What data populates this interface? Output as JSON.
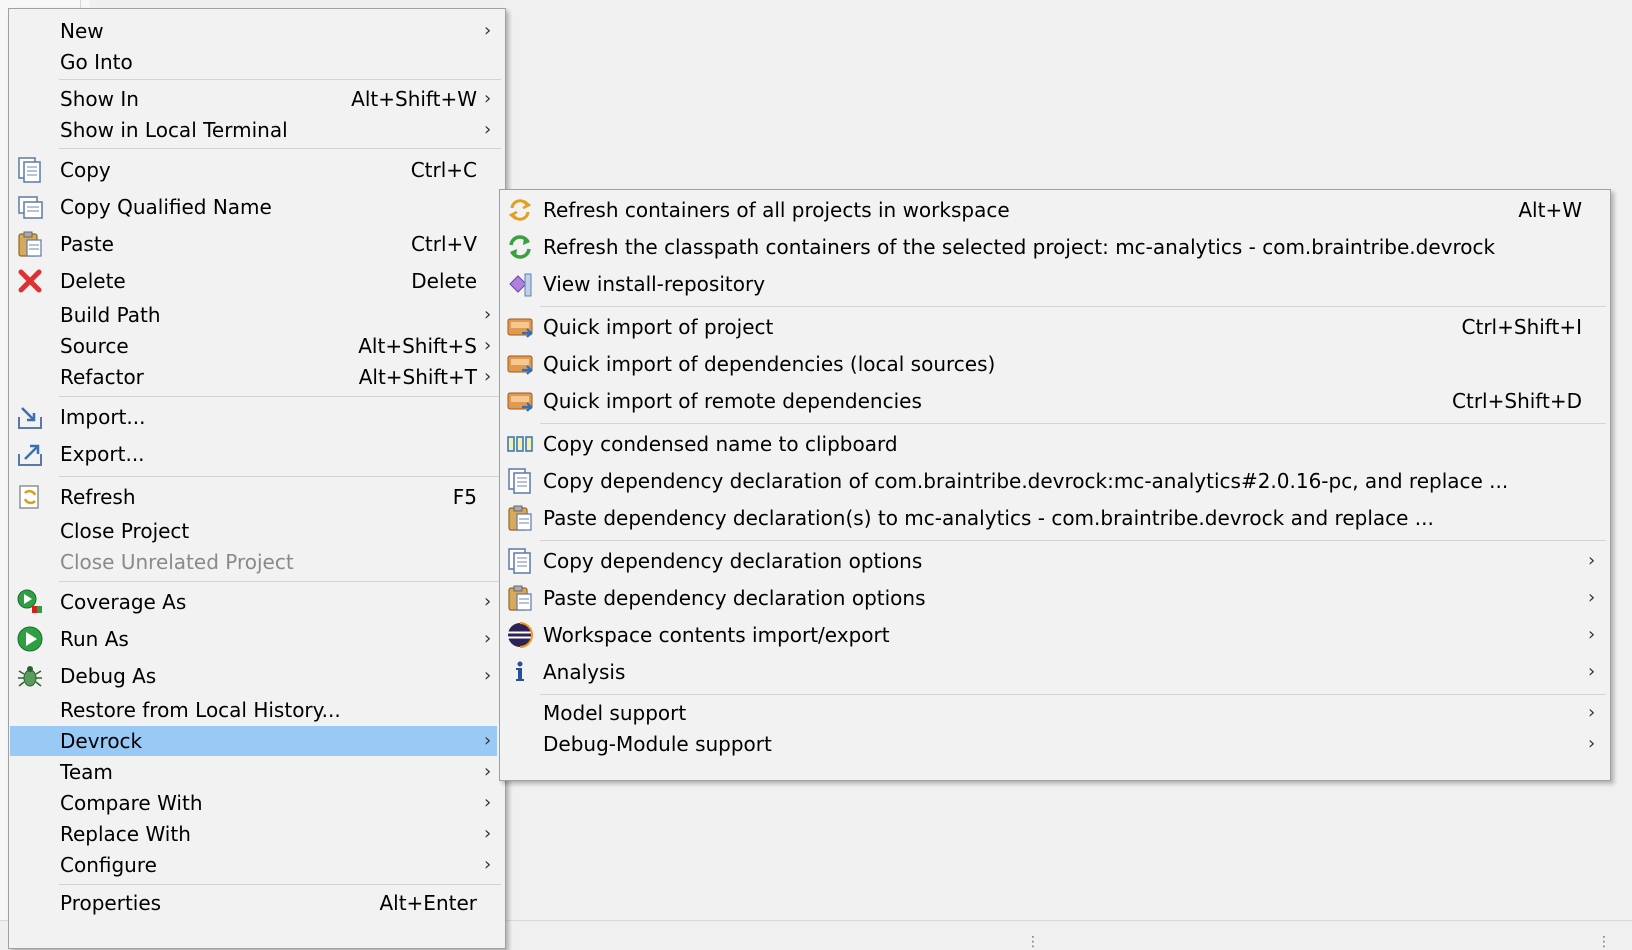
{
  "main_menu": {
    "items": [
      {
        "label": "New",
        "shortcut": "",
        "submenu": true
      },
      {
        "label": "Go Into",
        "shortcut": "",
        "submenu": false
      },
      {
        "label": "Show In",
        "shortcut": "Alt+Shift+W",
        "submenu": true
      },
      {
        "label": "Show in Local Terminal",
        "shortcut": "",
        "submenu": true
      },
      {
        "label": "Copy",
        "shortcut": "Ctrl+C",
        "submenu": false,
        "icon": "copy-icon"
      },
      {
        "label": "Copy Qualified Name",
        "shortcut": "",
        "submenu": false,
        "icon": "copy-qualified-name-icon"
      },
      {
        "label": "Paste",
        "shortcut": "Ctrl+V",
        "submenu": false,
        "icon": "paste-icon"
      },
      {
        "label": "Delete",
        "shortcut": "Delete",
        "submenu": false,
        "icon": "delete-icon"
      },
      {
        "label": "Build Path",
        "shortcut": "",
        "submenu": true
      },
      {
        "label": "Source",
        "shortcut": "Alt+Shift+S",
        "submenu": true
      },
      {
        "label": "Refactor",
        "shortcut": "Alt+Shift+T",
        "submenu": true
      },
      {
        "label": "Import...",
        "shortcut": "",
        "submenu": false,
        "icon": "import-icon"
      },
      {
        "label": "Export...",
        "shortcut": "",
        "submenu": false,
        "icon": "export-icon"
      },
      {
        "label": "Refresh",
        "shortcut": "F5",
        "submenu": false,
        "icon": "refresh-icon"
      },
      {
        "label": "Close Project",
        "shortcut": "",
        "submenu": false
      },
      {
        "label": "Close Unrelated Project",
        "shortcut": "",
        "submenu": false,
        "disabled": true
      },
      {
        "label": "Coverage As",
        "shortcut": "",
        "submenu": true,
        "icon": "coverage-icon"
      },
      {
        "label": "Run As",
        "shortcut": "",
        "submenu": true,
        "icon": "run-icon"
      },
      {
        "label": "Debug As",
        "shortcut": "",
        "submenu": true,
        "icon": "debug-bug-icon"
      },
      {
        "label": "Restore from Local History...",
        "shortcut": "",
        "submenu": false
      },
      {
        "label": "Devrock",
        "shortcut": "",
        "submenu": true,
        "highlighted": true
      },
      {
        "label": "Team",
        "shortcut": "",
        "submenu": true
      },
      {
        "label": "Compare With",
        "shortcut": "",
        "submenu": true
      },
      {
        "label": "Replace With",
        "shortcut": "",
        "submenu": true
      },
      {
        "label": "Configure",
        "shortcut": "",
        "submenu": true
      },
      {
        "label": "Properties",
        "shortcut": "Alt+Enter",
        "submenu": false
      }
    ]
  },
  "devrock_submenu": {
    "items": [
      {
        "label": "Refresh containers of all projects in workspace",
        "shortcut": "Alt+W",
        "submenu": false,
        "icon": "refresh-containers-icon"
      },
      {
        "label": "Refresh the classpath containers of the selected project: mc-analytics - com.braintribe.devrock",
        "shortcut": "",
        "submenu": false,
        "icon": "refresh-classpath-icon"
      },
      {
        "label": "View install-repository",
        "shortcut": "",
        "submenu": false,
        "icon": "install-repository-icon"
      },
      {
        "label": "Quick import of project",
        "shortcut": "Ctrl+Shift+I",
        "submenu": false,
        "icon": "quick-import-icon"
      },
      {
        "label": "Quick import of dependencies (local sources)",
        "shortcut": "",
        "submenu": false,
        "icon": "quick-import-icon"
      },
      {
        "label": "Quick import of remote dependencies",
        "shortcut": "Ctrl+Shift+D",
        "submenu": false,
        "icon": "quick-import-icon"
      },
      {
        "label": "Copy condensed name to clipboard",
        "shortcut": "",
        "submenu": false,
        "icon": "condensed-name-icon"
      },
      {
        "label": "Copy dependency declaration of com.braintribe.devrock:mc-analytics#2.0.16-pc, and replace ...",
        "shortcut": "",
        "submenu": false,
        "icon": "copy-icon"
      },
      {
        "label": "Paste dependency declaration(s) to mc-analytics - com.braintribe.devrock and replace ...",
        "shortcut": "",
        "submenu": false,
        "icon": "paste-icon"
      },
      {
        "label": "Copy dependency declaration options",
        "shortcut": "",
        "submenu": true,
        "icon": "copy-icon"
      },
      {
        "label": "Paste dependency declaration options",
        "shortcut": "",
        "submenu": true,
        "icon": "paste-icon"
      },
      {
        "label": "Workspace contents import/export",
        "shortcut": "",
        "submenu": true,
        "icon": "eclipse-icon"
      },
      {
        "label": "Analysis",
        "shortcut": "",
        "submenu": true,
        "icon": "info-icon"
      },
      {
        "label": "Model support",
        "shortcut": "",
        "submenu": true
      },
      {
        "label": "Debug-Module support",
        "shortcut": "",
        "submenu": true
      }
    ]
  },
  "submenu_arrow": "›",
  "colors": {
    "menu_bg": "#f2f2f2",
    "highlight": "#99c9f5",
    "separator": "#d4d4d4",
    "disabled_text": "#8a8a8a"
  }
}
